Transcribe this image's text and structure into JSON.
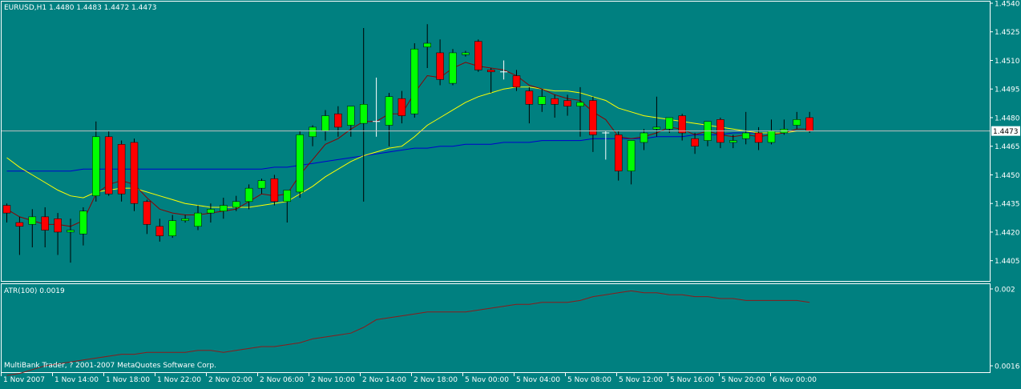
{
  "chart_header": "EURUSD,H1  1.4480 1.4483 1.4472 1.4473",
  "indicator_header": "ATR(100) 0.0019",
  "footer_text": "MultiBank Trader, ? 2001-2007 MetaQuotes Software Corp.",
  "colors": {
    "background": "#008080",
    "frame": "#ffffff",
    "bull": "#00ff00",
    "bear": "#ff0000",
    "doji": "#ffffff",
    "wick": "#000000",
    "ma_fast": "#8b0000",
    "ma_slow": "#ffff00",
    "ma_long": "#0000cd",
    "atr": "#8b1a1a",
    "price_line": "#c0c0c0",
    "price_badge_bg": "#ffffff",
    "price_badge_text": "#000000"
  },
  "chart_data": [
    {
      "type": "candlestick",
      "symbol": "EURUSD",
      "timeframe": "H1",
      "last_price": "1.4473",
      "ylim": [
        1.44,
        1.454
      ],
      "y_ticks": [
        "1.4540",
        "1.4525",
        "1.4510",
        "1.4495",
        "1.4480",
        "1.4465",
        "1.4450",
        "1.4435",
        "1.4420",
        "1.4405"
      ],
      "x_tick_labels": [
        "1 Nov 2007",
        "1 Nov 14:00",
        "1 Nov 18:00",
        "1 Nov 22:00",
        "2 Nov 02:00",
        "2 Nov 06:00",
        "2 Nov 10:00",
        "2 Nov 14:00",
        "2 Nov 18:00",
        "5 Nov 00:00",
        "5 Nov 04:00",
        "5 Nov 08:00",
        "5 Nov 12:00",
        "5 Nov 16:00",
        "5 Nov 20:00",
        "6 Nov 00:00"
      ],
      "candles": [
        {
          "o": 1.4434,
          "h": 1.4435,
          "l": 1.4425,
          "c": 1.443
        },
        {
          "o": 1.4425,
          "h": 1.4428,
          "l": 1.4408,
          "c": 1.4423
        },
        {
          "o": 1.4424,
          "h": 1.4432,
          "l": 1.4412,
          "c": 1.4428
        },
        {
          "o": 1.4428,
          "h": 1.4433,
          "l": 1.4412,
          "c": 1.4421
        },
        {
          "o": 1.4427,
          "h": 1.443,
          "l": 1.4408,
          "c": 1.442
        },
        {
          "o": 1.442,
          "h": 1.4427,
          "l": 1.4404,
          "c": 1.4421
        },
        {
          "o": 1.4419,
          "h": 1.4433,
          "l": 1.4413,
          "c": 1.4431
        },
        {
          "o": 1.4439,
          "h": 1.4478,
          "l": 1.4436,
          "c": 1.447
        },
        {
          "o": 1.447,
          "h": 1.4473,
          "l": 1.4439,
          "c": 1.444
        },
        {
          "o": 1.4466,
          "h": 1.4468,
          "l": 1.4436,
          "c": 1.444
        },
        {
          "o": 1.4467,
          "h": 1.4469,
          "l": 1.4431,
          "c": 1.4435
        },
        {
          "o": 1.4436,
          "h": 1.4437,
          "l": 1.4419,
          "c": 1.4424
        },
        {
          "o": 1.4423,
          "h": 1.4427,
          "l": 1.4415,
          "c": 1.4418
        },
        {
          "o": 1.4418,
          "h": 1.4429,
          "l": 1.4417,
          "c": 1.4426
        },
        {
          "o": 1.4426,
          "h": 1.4429,
          "l": 1.4425,
          "c": 1.4427
        },
        {
          "o": 1.4423,
          "h": 1.4434,
          "l": 1.4421,
          "c": 1.443
        },
        {
          "o": 1.443,
          "h": 1.4435,
          "l": 1.4425,
          "c": 1.4432
        },
        {
          "o": 1.4431,
          "h": 1.4438,
          "l": 1.4427,
          "c": 1.4434
        },
        {
          "o": 1.4433,
          "h": 1.4439,
          "l": 1.4431,
          "c": 1.4436
        },
        {
          "o": 1.4436,
          "h": 1.4445,
          "l": 1.4432,
          "c": 1.4443
        },
        {
          "o": 1.4443,
          "h": 1.4448,
          "l": 1.444,
          "c": 1.4447
        },
        {
          "o": 1.4448,
          "h": 1.445,
          "l": 1.4434,
          "c": 1.4436
        },
        {
          "o": 1.4436,
          "h": 1.4442,
          "l": 1.4425,
          "c": 1.4442
        },
        {
          "o": 1.4441,
          "h": 1.4473,
          "l": 1.4438,
          "c": 1.4471
        },
        {
          "o": 1.447,
          "h": 1.4476,
          "l": 1.4465,
          "c": 1.4475
        },
        {
          "o": 1.4473,
          "h": 1.4484,
          "l": 1.4468,
          "c": 1.4481
        },
        {
          "o": 1.4482,
          "h": 1.4486,
          "l": 1.447,
          "c": 1.4475
        },
        {
          "o": 1.4476,
          "h": 1.4483,
          "l": 1.447,
          "c": 1.4486
        },
        {
          "o": 1.4477,
          "h": 1.4527,
          "l": 1.4436,
          "c": 1.4487
        },
        {
          "o": 1.4478,
          "h": 1.4501,
          "l": 1.447,
          "c": 1.4478
        },
        {
          "o": 1.4476,
          "h": 1.4493,
          "l": 1.4465,
          "c": 1.4491
        },
        {
          "o": 1.449,
          "h": 1.4494,
          "l": 1.4477,
          "c": 1.4481
        },
        {
          "o": 1.4482,
          "h": 1.4519,
          "l": 1.448,
          "c": 1.4516
        },
        {
          "o": 1.4517,
          "h": 1.4529,
          "l": 1.4506,
          "c": 1.4519
        },
        {
          "o": 1.4514,
          "h": 1.4521,
          "l": 1.4497,
          "c": 1.45
        },
        {
          "o": 1.4498,
          "h": 1.4516,
          "l": 1.4497,
          "c": 1.4514
        },
        {
          "o": 1.4513,
          "h": 1.4515,
          "l": 1.4512,
          "c": 1.4514
        },
        {
          "o": 1.452,
          "h": 1.4521,
          "l": 1.4504,
          "c": 1.4505
        },
        {
          "o": 1.4505,
          "h": 1.4506,
          "l": 1.4493,
          "c": 1.4504
        },
        {
          "o": 1.4504,
          "h": 1.451,
          "l": 1.45,
          "c": 1.4504
        },
        {
          "o": 1.4502,
          "h": 1.4505,
          "l": 1.4494,
          "c": 1.4496
        },
        {
          "o": 1.4494,
          "h": 1.4496,
          "l": 1.4477,
          "c": 1.4487
        },
        {
          "o": 1.4487,
          "h": 1.4495,
          "l": 1.4483,
          "c": 1.4491
        },
        {
          "o": 1.449,
          "h": 1.4492,
          "l": 1.448,
          "c": 1.4487
        },
        {
          "o": 1.4489,
          "h": 1.4492,
          "l": 1.4481,
          "c": 1.4486
        },
        {
          "o": 1.4486,
          "h": 1.4496,
          "l": 1.447,
          "c": 1.4488
        },
        {
          "o": 1.4489,
          "h": 1.4491,
          "l": 1.4462,
          "c": 1.4471
        },
        {
          "o": 1.4472,
          "h": 1.4473,
          "l": 1.4458,
          "c": 1.4472
        },
        {
          "o": 1.4471,
          "h": 1.4473,
          "l": 1.4447,
          "c": 1.4452
        },
        {
          "o": 1.4452,
          "h": 1.4468,
          "l": 1.4445,
          "c": 1.4468
        },
        {
          "o": 1.4467,
          "h": 1.4474,
          "l": 1.4463,
          "c": 1.4472
        },
        {
          "o": 1.4474,
          "h": 1.4491,
          "l": 1.447,
          "c": 1.4475
        },
        {
          "o": 1.4474,
          "h": 1.448,
          "l": 1.4472,
          "c": 1.448
        },
        {
          "o": 1.4481,
          "h": 1.4482,
          "l": 1.4468,
          "c": 1.4472
        },
        {
          "o": 1.4469,
          "h": 1.4472,
          "l": 1.4461,
          "c": 1.4465
        },
        {
          "o": 1.4468,
          "h": 1.4478,
          "l": 1.4465,
          "c": 1.4478
        },
        {
          "o": 1.4479,
          "h": 1.448,
          "l": 1.4464,
          "c": 1.4467
        },
        {
          "o": 1.4467,
          "h": 1.4471,
          "l": 1.4464,
          "c": 1.4468
        },
        {
          "o": 1.4469,
          "h": 1.4483,
          "l": 1.4466,
          "c": 1.4472
        },
        {
          "o": 1.4472,
          "h": 1.4475,
          "l": 1.4463,
          "c": 1.4467
        },
        {
          "o": 1.4467,
          "h": 1.4479,
          "l": 1.4466,
          "c": 1.4473
        },
        {
          "o": 1.4472,
          "h": 1.4479,
          "l": 1.4471,
          "c": 1.4474
        },
        {
          "o": 1.4476,
          "h": 1.4483,
          "l": 1.4474,
          "c": 1.4479
        },
        {
          "o": 1.448,
          "h": 1.4483,
          "l": 1.4472,
          "c": 1.4473
        }
      ],
      "ma_fast": [
        1.4432,
        1.4428,
        1.4426,
        1.4424,
        1.4424,
        1.4423,
        1.4426,
        1.444,
        1.4445,
        1.4447,
        1.4445,
        1.4438,
        1.4432,
        1.443,
        1.4429,
        1.4429,
        1.443,
        1.4431,
        1.4432,
        1.4436,
        1.444,
        1.4439,
        1.444,
        1.445,
        1.4458,
        1.4466,
        1.4469,
        1.4474,
        1.4478,
        1.4478,
        1.4482,
        1.4482,
        1.4493,
        1.4502,
        1.4501,
        1.4506,
        1.4509,
        1.4507,
        1.4506,
        1.4505,
        1.4502,
        1.4497,
        1.4495,
        1.4492,
        1.449,
        1.4489,
        1.4483,
        1.4479,
        1.447,
        1.4469,
        1.447,
        1.4472,
        1.4475,
        1.4474,
        1.4471,
        1.4473,
        1.4471,
        1.447,
        1.4471,
        1.447,
        1.4471,
        1.4472,
        1.4474,
        1.4474
      ],
      "ma_slow": [
        1.4459,
        1.4454,
        1.445,
        1.4446,
        1.4442,
        1.4439,
        1.4438,
        1.4441,
        1.4442,
        1.4443,
        1.4443,
        1.4441,
        1.4439,
        1.4437,
        1.4435,
        1.4434,
        1.4433,
        1.4433,
        1.4433,
        1.4433,
        1.4434,
        1.4435,
        1.4436,
        1.444,
        1.4444,
        1.4449,
        1.4453,
        1.4457,
        1.446,
        1.4462,
        1.4464,
        1.4465,
        1.447,
        1.4476,
        1.448,
        1.4484,
        1.4488,
        1.4491,
        1.4493,
        1.4495,
        1.4496,
        1.4496,
        1.4495,
        1.4494,
        1.4494,
        1.4493,
        1.4491,
        1.4489,
        1.4485,
        1.4483,
        1.4481,
        1.448,
        1.4479,
        1.4478,
        1.4477,
        1.4476,
        1.4475,
        1.4474,
        1.4473,
        1.4472,
        1.4472,
        1.4472,
        1.4473,
        1.4473
      ],
      "ma_long": [
        1.4452,
        1.4452,
        1.4452,
        1.4452,
        1.4452,
        1.4452,
        1.4453,
        1.4453,
        1.4453,
        1.4453,
        1.4453,
        1.4453,
        1.4453,
        1.4453,
        1.4453,
        1.4453,
        1.4453,
        1.4453,
        1.4453,
        1.4453,
        1.4453,
        1.4454,
        1.4454,
        1.4455,
        1.4456,
        1.4457,
        1.4458,
        1.4459,
        1.446,
        1.4461,
        1.4462,
        1.4463,
        1.4464,
        1.4464,
        1.4465,
        1.4465,
        1.4466,
        1.4466,
        1.4466,
        1.4467,
        1.4467,
        1.4467,
        1.4468,
        1.4468,
        1.4468,
        1.4468,
        1.4469,
        1.4469,
        1.4469,
        1.4469,
        1.4469,
        1.447,
        1.447,
        1.447,
        1.4471,
        1.4471,
        1.4471,
        1.4472,
        1.4472,
        1.4472,
        1.4472,
        1.4472,
        1.4473,
        1.4473
      ]
    },
    {
      "type": "line",
      "name": "ATR(100)",
      "current_value": "0.0019",
      "ylim": [
        0.0016,
        0.002
      ],
      "y_ticks": [
        "0.002",
        "0.0016"
      ],
      "values": [
        0.00155,
        0.00156,
        0.00158,
        0.0016,
        0.00161,
        0.00162,
        0.00163,
        0.00164,
        0.00165,
        0.00166,
        0.00166,
        0.00167,
        0.00167,
        0.00167,
        0.00167,
        0.00168,
        0.00168,
        0.00167,
        0.00168,
        0.00169,
        0.0017,
        0.0017,
        0.00171,
        0.00172,
        0.00174,
        0.00175,
        0.00176,
        0.00177,
        0.0018,
        0.00184,
        0.00185,
        0.00186,
        0.00187,
        0.00188,
        0.00188,
        0.00188,
        0.00188,
        0.00189,
        0.0019,
        0.00191,
        0.00192,
        0.00192,
        0.00193,
        0.00193,
        0.00193,
        0.00194,
        0.00196,
        0.00197,
        0.00198,
        0.00199,
        0.00198,
        0.00198,
        0.00197,
        0.00197,
        0.00196,
        0.00196,
        0.00195,
        0.00195,
        0.00194,
        0.00194,
        0.00194,
        0.00194,
        0.00194,
        0.00193
      ]
    }
  ]
}
